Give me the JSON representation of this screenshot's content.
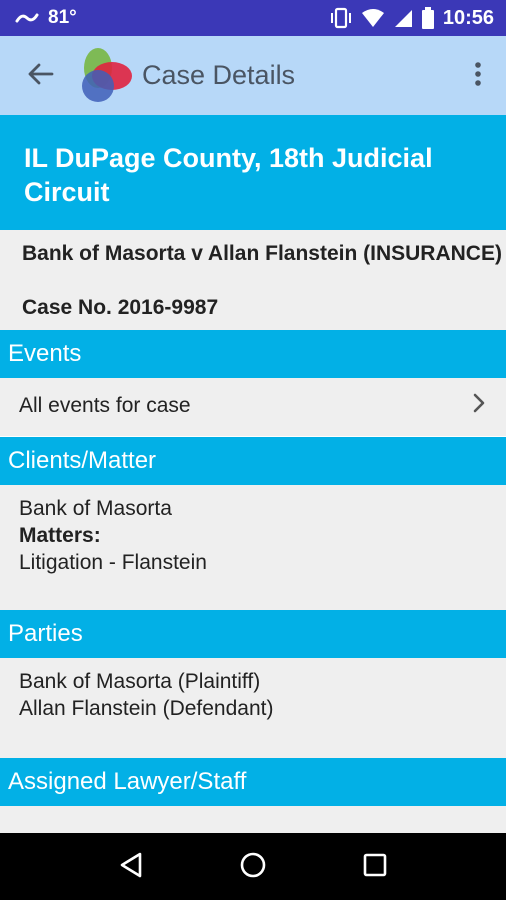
{
  "status_bar": {
    "temperature": "81°",
    "time": "10:56",
    "icons": [
      "weather-icon",
      "vibrate-icon",
      "wifi-icon",
      "signal-icon",
      "battery-icon"
    ]
  },
  "app_bar": {
    "title": "Case Details",
    "background": "#b7d8f8"
  },
  "case": {
    "court": "IL DuPage County, 18th Judicial Circuit",
    "name": "Bank of Masorta v Allan Flanstein (INSURANCE)",
    "number": "Case No. 2016-9987"
  },
  "sections": {
    "events": {
      "title": "Events",
      "row_label": "All events for case"
    },
    "clients": {
      "title": "Clients/Matter",
      "client": "Bank of Masorta",
      "matters_label": "Matters:",
      "matter": "Litigation - Flanstein"
    },
    "parties": {
      "title": "Parties",
      "items": [
        "Bank of Masorta (Plaintiff)",
        "Allan Flanstein (Defendant)"
      ]
    },
    "assigned": {
      "title": "Assigned Lawyer/Staff"
    }
  },
  "colors": {
    "accent": "#02b0e6",
    "status_bar": "#3b38b7",
    "body_bg": "#efefef"
  }
}
